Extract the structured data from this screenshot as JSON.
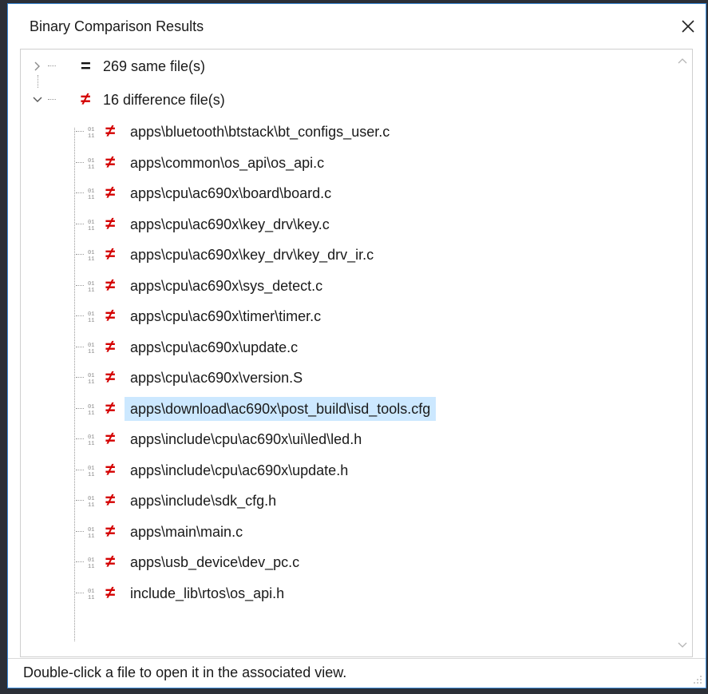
{
  "window": {
    "title": "Binary Comparison Results",
    "close_icon": "close-icon"
  },
  "tree": {
    "same": {
      "symbol": "=",
      "label": "269 same file(s)",
      "expanded": false
    },
    "diff": {
      "symbol": "≠",
      "label": "16 difference file(s)",
      "expanded": true
    },
    "diff_symbol": "≠",
    "files": [
      "apps\\bluetooth\\btstack\\bt_configs_user.c",
      "apps\\common\\os_api\\os_api.c",
      "apps\\cpu\\ac690x\\board\\board.c",
      "apps\\cpu\\ac690x\\key_drv\\key.c",
      "apps\\cpu\\ac690x\\key_drv\\key_drv_ir.c",
      "apps\\cpu\\ac690x\\sys_detect.c",
      "apps\\cpu\\ac690x\\timer\\timer.c",
      "apps\\cpu\\ac690x\\update.c",
      "apps\\cpu\\ac690x\\version.S",
      "apps\\download\\ac690x\\post_build\\isd_tools.cfg",
      "apps\\include\\cpu\\ac690x\\ui\\led\\led.h",
      "apps\\include\\cpu\\ac690x\\update.h",
      "apps\\include\\sdk_cfg.h",
      "apps\\main\\main.c",
      "apps\\usb_device\\dev_pc.c",
      "include_lib\\rtos\\os_api.h"
    ],
    "selected_file": "apps\\download\\ac690x\\post_build\\isd_tools.cfg"
  },
  "status": {
    "text": "Double-click a file to open it in the associated view."
  },
  "colors": {
    "accent_border": "#3b8ad8",
    "diff_red": "#d40000",
    "selection": "#cce8ff"
  }
}
